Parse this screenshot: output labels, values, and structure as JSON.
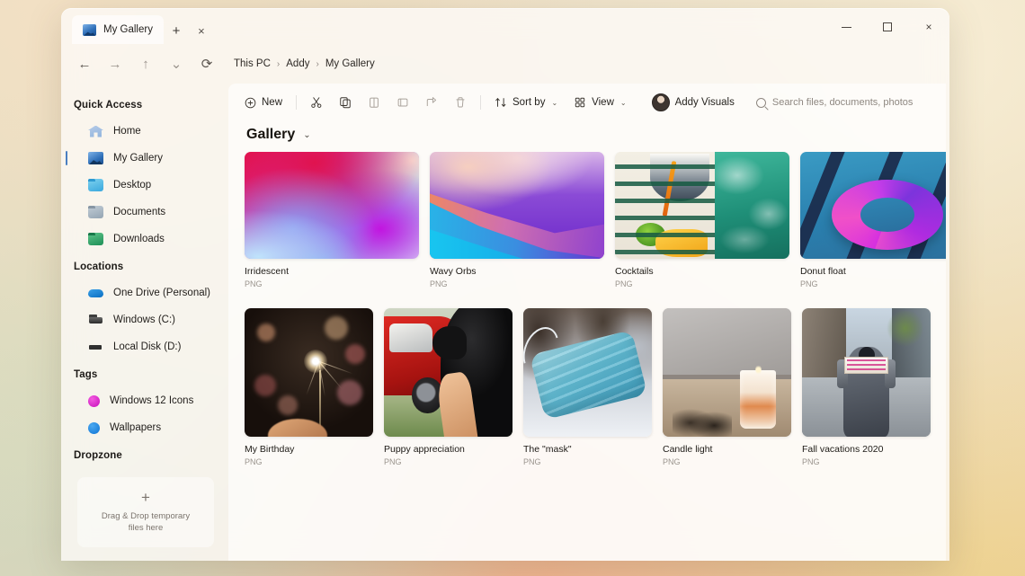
{
  "window": {
    "tab_title": "My Gallery",
    "new_tab_label": "+",
    "close_tab_label": "×",
    "minimize_label": "—",
    "maximize_label": "□",
    "close_label": "×"
  },
  "nav": {
    "back": "←",
    "forward": "→",
    "up": "↑",
    "history": "⌄",
    "refresh": "⟳",
    "breadcrumbs": [
      "This PC",
      "Addy",
      "My Gallery"
    ],
    "separator": "›"
  },
  "toolbar": {
    "new_label": "New",
    "cut_label": "Cut",
    "copy_label": "Copy",
    "paste_label": "Paste",
    "rename_label": "Rename",
    "share_label": "Share",
    "delete_label": "Delete",
    "sort_label": "Sort by",
    "view_label": "View",
    "chevron": "⌄",
    "account_name": "Addy Visuals",
    "search_placeholder": "Search files, documents, photos"
  },
  "sidebar": {
    "sections": [
      {
        "title": "Quick Access",
        "items": [
          {
            "label": "Home",
            "icon": "home-icon",
            "active": false
          },
          {
            "label": "My Gallery",
            "icon": "gallery-icon",
            "active": true
          },
          {
            "label": "Desktop",
            "icon": "folder-desktop-icon",
            "active": false
          },
          {
            "label": "Documents",
            "icon": "folder-documents-icon",
            "active": false
          },
          {
            "label": "Downloads",
            "icon": "folder-downloads-icon",
            "active": false
          }
        ]
      },
      {
        "title": "Locations",
        "items": [
          {
            "label": "One Drive (Personal)",
            "icon": "cloud-icon",
            "active": false
          },
          {
            "label": "Windows (C:)",
            "icon": "drive-icon",
            "active": false
          },
          {
            "label": "Local Disk (D:)",
            "icon": "disk-icon",
            "active": false
          }
        ]
      },
      {
        "title": "Tags",
        "items": [
          {
            "label": "Windows 12 Icons",
            "icon": "tag-dot-magenta-icon",
            "active": false
          },
          {
            "label": "Wallpapers",
            "icon": "tag-dot-blue-icon",
            "active": false
          }
        ]
      }
    ],
    "dropzone": {
      "title": "Dropzone",
      "plus": "+",
      "line1": "Drag & Drop temporary",
      "line2": "files here"
    }
  },
  "gallery": {
    "title": "Gallery",
    "chevron": "⌄",
    "rows": [
      {
        "size": "wide",
        "items": [
          {
            "name": "Irridescent",
            "type": "PNG",
            "art": "art-irridescent"
          },
          {
            "name": "Wavy Orbs",
            "type": "PNG",
            "art": "art-wavy"
          },
          {
            "name": "Cocktails",
            "type": "PNG",
            "art": "art-cocktails"
          },
          {
            "name": "Donut float",
            "type": "PNG",
            "art": "art-donut"
          }
        ]
      },
      {
        "size": "square",
        "items": [
          {
            "name": "My Birthday",
            "type": "PNG",
            "art": "art-birthday"
          },
          {
            "name": "Puppy appreciation",
            "type": "PNG",
            "art": "art-puppy"
          },
          {
            "name": "The \"mask\"",
            "type": "PNG",
            "art": "art-mask"
          },
          {
            "name": "Candle light",
            "type": "PNG",
            "art": "art-candle"
          },
          {
            "name": "Fall vacations 2020",
            "type": "PNG",
            "art": "art-fall"
          }
        ]
      }
    ]
  },
  "colors": {
    "accent": "#4a7fc1",
    "tag_magenta": "#c50fba",
    "tag_blue": "#0d74d4",
    "text_primary": "#1d1a16",
    "text_muted": "#9a948d"
  }
}
